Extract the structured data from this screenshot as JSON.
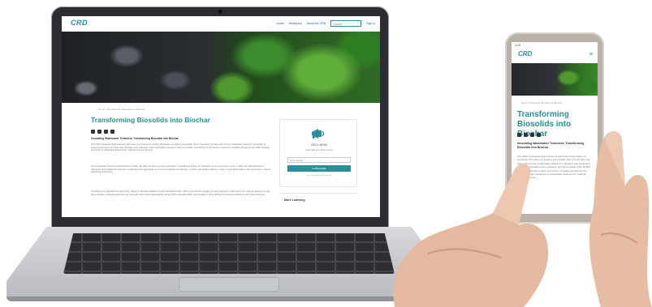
{
  "laptop_site": {
    "logo": "CRD",
    "nav": [
      "Home",
      "Wellspace",
      "About the CRD"
    ],
    "search_placeholder": "Search",
    "signin": "Sign in",
    "breadcrumb": "Home / Transforming Biosolids into Biochar",
    "title": "Transforming Biosolids into Biochar",
    "lead": "Innovating Wastewater Treatment: Transforming Biosolids into Biochar",
    "paragraphs": [
      "The CRD's biological liquid treatment plant has a long history of providing information on treating its biosolids. Since it launched, the team will use from wastewater treatment, this facility, to advance and implement high-value biosolids reuse pathways, make sustainable processes, and divert wastes. This will be the first project of its kind in Canada and features the CRD's strategic investment in wastewater treatment for material resource recovery.",
      "This wastewater treatment was introduced in 2020, the CRD has been pursuing cooperation, cost-effective options for beneficial use for community benefit. In 2021, the CRD launched an Alternative technological procurement to help bring new approaches to converting biosolids into biochar - a carbon-rich product offering a variety of potential benefits to the environment, industry, agriculture and forestry.",
      "Considering the potential and opportunity, trialing to ultimately establish a local sustainable facility. CRD environmental management and engineering staff support the regional planning process, also providing a material solution for the community with a new biochar facility, along with the potential facility, grant funding in full in 2025 and for future beneficial use and future decisions."
    ],
    "sidebar": {
      "heading": "CRD E-NEWS",
      "sub": "Subscribe for updates below",
      "email_placeholder": "Email address",
      "button": "SUBSCRIBE",
      "note": "You can unsubscribe at any time",
      "section_title": "More Listening"
    }
  },
  "phone_site": {
    "status_time": "1:20",
    "logo": "CRD",
    "breadcrumb": "Home / Transforming Biosolids into Biochar",
    "title": "Transforming Biosolids into Biochar",
    "lead": "Innovating Wastewater Treatment: Transforming Biosolids into Biochar",
    "paragraph": "The CRD's biological liquid treatment plant has a long history of providing information on treating its biosolids. Since it launched, the team will use from wastewater treatment to advance and implement high-value biosolids reuse pathways, and divert wastes from landfill. This will be the first project of its kind in Canada and features the CRD's strategic investment in wastewater treatment for material resource recovery."
  },
  "colors": {
    "brand_teal": "#2a8f9b",
    "laptop_bezel": "#2b2d30",
    "phone_body": "#b9b2a9"
  }
}
